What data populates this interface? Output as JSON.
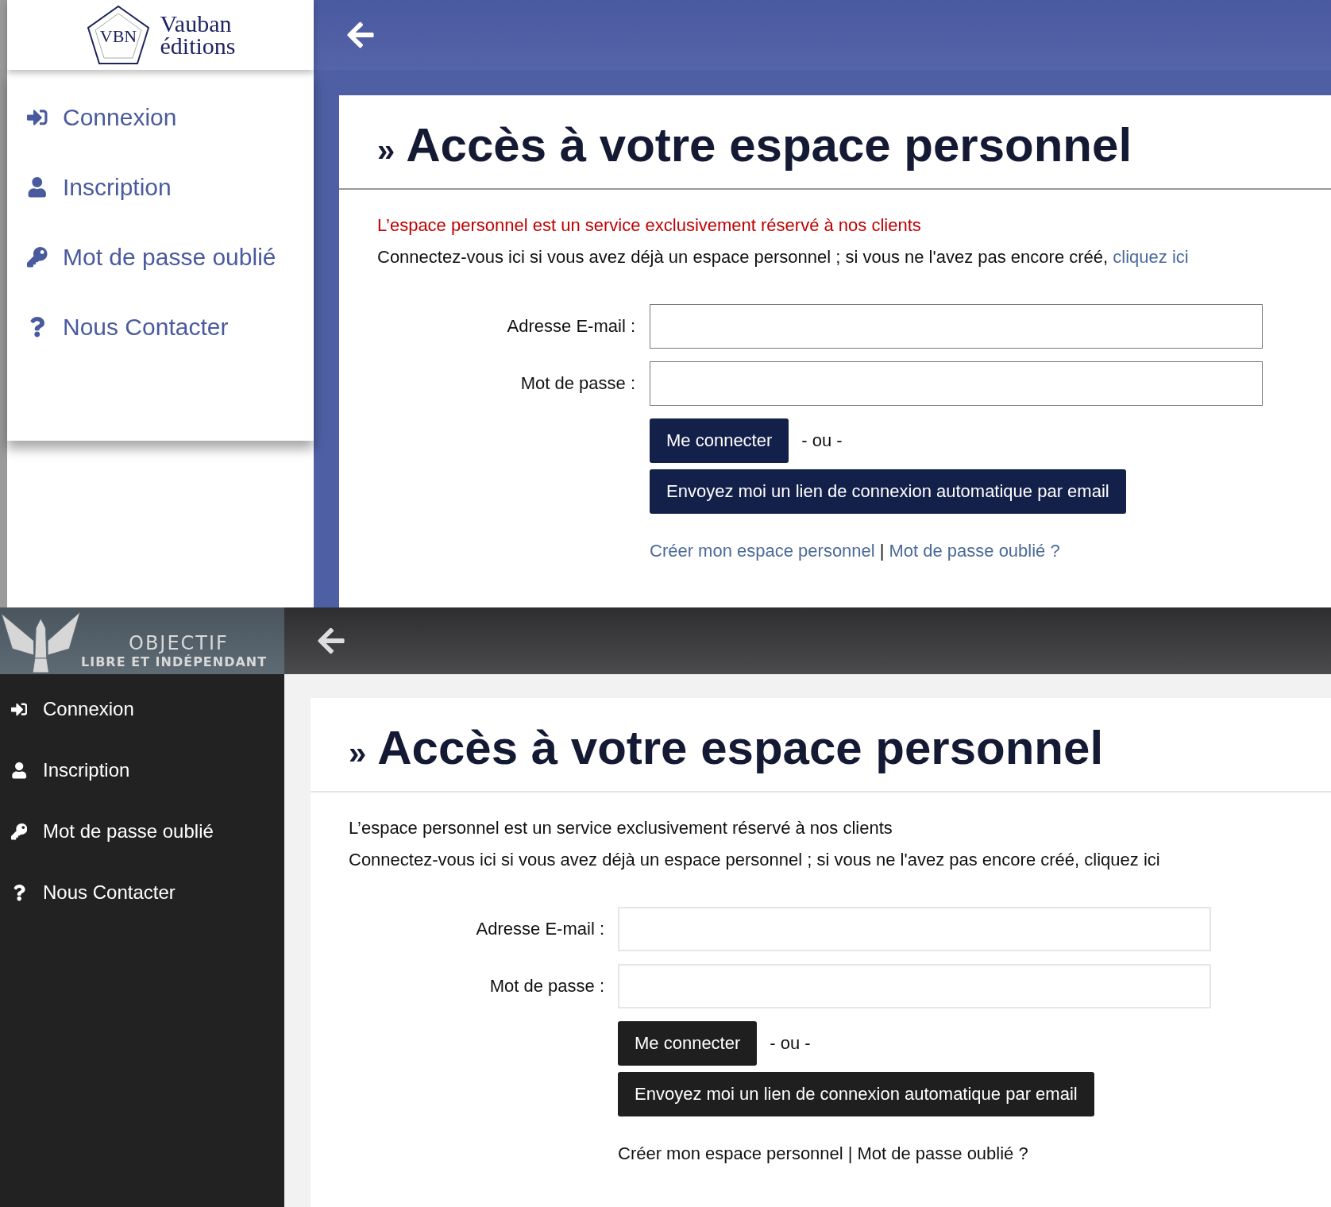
{
  "panels": [
    {
      "logo": {
        "kind": "vauban",
        "monogram": "VBN",
        "lines": [
          "Vauban",
          "éditions"
        ]
      },
      "nav": [
        {
          "label": "Connexion"
        },
        {
          "label": "Inscription"
        },
        {
          "label": "Mot de passe oublié"
        },
        {
          "label": "Nous Contacter"
        }
      ],
      "title_mark": "»",
      "title": "Accès à votre espace personnel",
      "notice": "L’espace personnel est un service exclusivement réservé à nos clients",
      "intro": "Connectez-vous ici si vous avez déjà un espace personnel ; si vous ne l'avez pas encore créé,",
      "intro_link": "cliquez ici",
      "fields": [
        {
          "label": "Adresse E-mail :"
        },
        {
          "label": "Mot de passe :"
        }
      ],
      "login_button": "Me connecter",
      "separator": "- ou -",
      "magic_button": "Envoyez moi un lien de connexion automatique par email",
      "links": [
        "Créer mon espace personnel",
        "Mot de passe oublié ?"
      ],
      "link_separator": "|"
    },
    {
      "logo": {
        "kind": "objectif",
        "lines": [
          "OBJECTIF",
          "LIBRE ET INDÉPENDANT"
        ]
      },
      "nav": [
        {
          "label": "Connexion"
        },
        {
          "label": "Inscription"
        },
        {
          "label": "Mot de passe oublié"
        },
        {
          "label": "Nous Contacter"
        }
      ],
      "title_mark": "»",
      "title": "Accès à votre espace personnel",
      "notice": "L’espace personnel est un service exclusivement réservé à nos clients",
      "intro": "Connectez-vous ici si vous avez déjà un espace personnel ; si vous ne l'avez pas encore créé,",
      "intro_link": "cliquez ici",
      "fields": [
        {
          "label": "Adresse E-mail :"
        },
        {
          "label": "Mot de passe :"
        }
      ],
      "login_button": "Me connecter",
      "separator": "- ou -",
      "magic_button": "Envoyez moi un lien de connexion automatique par email",
      "links": [
        "Créer mon espace personnel",
        "Mot de passe oublié ?"
      ],
      "link_separator": "|"
    }
  ]
}
